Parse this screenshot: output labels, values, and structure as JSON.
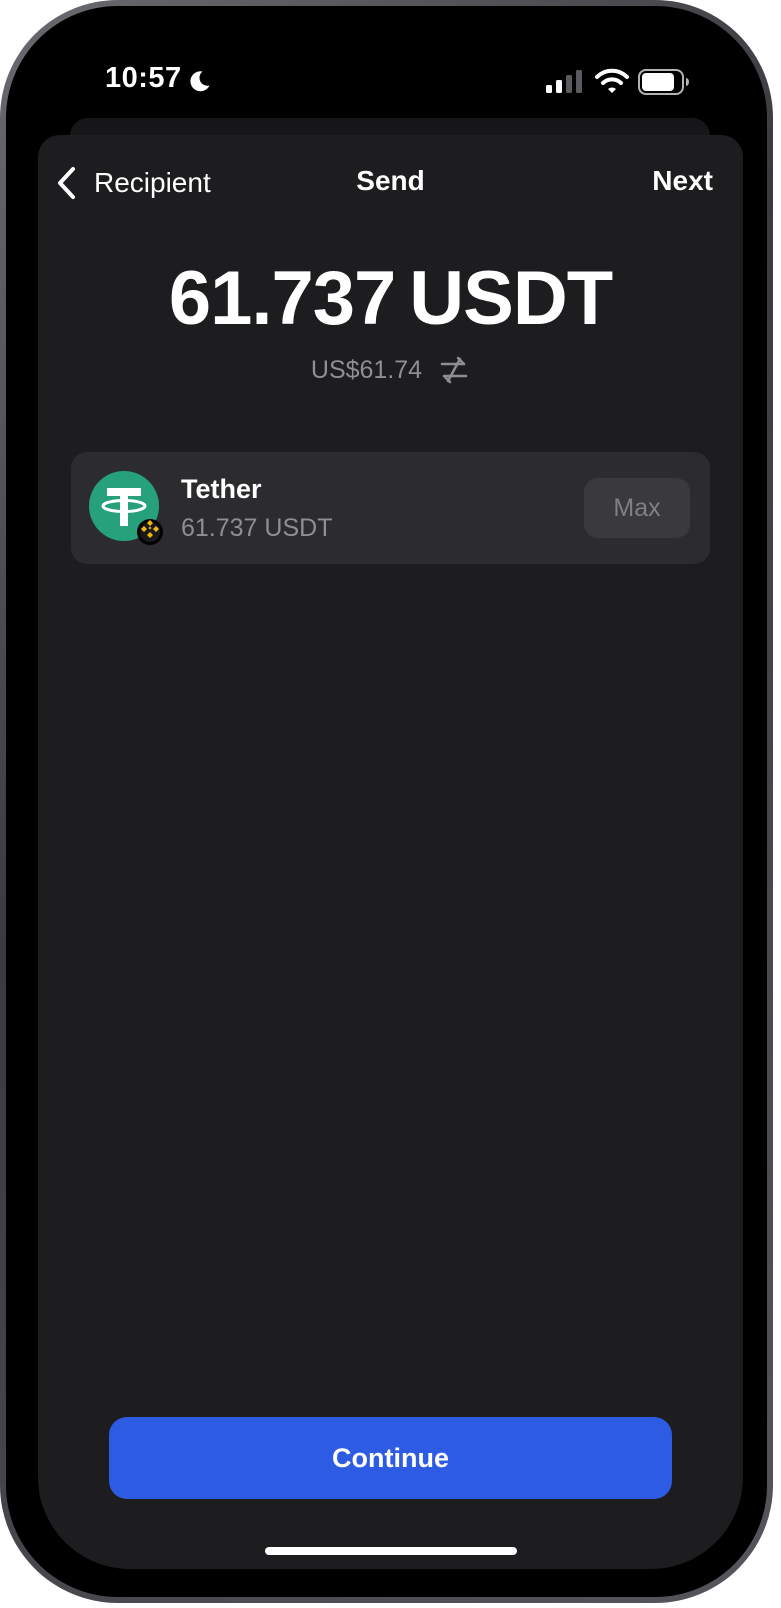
{
  "status_bar": {
    "time": "10:57",
    "icons": [
      "moon-icon",
      "signal-icon",
      "wifi-icon",
      "battery-icon"
    ]
  },
  "nav": {
    "back_label": "Recipient",
    "title": "Send",
    "next_label": "Next"
  },
  "amount": {
    "value": "61.737",
    "unit": "USDT"
  },
  "fiat": {
    "value": "US$61.74"
  },
  "asset": {
    "name": "Tether",
    "balance": "61.737 USDT",
    "max_label": "Max",
    "logo_icon": "tether-logo-icon",
    "network_icon": "bnb-chain-badge-icon"
  },
  "continue_label": "Continue",
  "colors": {
    "sheet_background": "#1d1d1f",
    "card_background": "#2c2c2e",
    "primary_button": "#2d5be3",
    "tether_green": "#26a17b",
    "bnb_yellow": "#f0b90b",
    "secondary_text": "#8e8e93"
  }
}
